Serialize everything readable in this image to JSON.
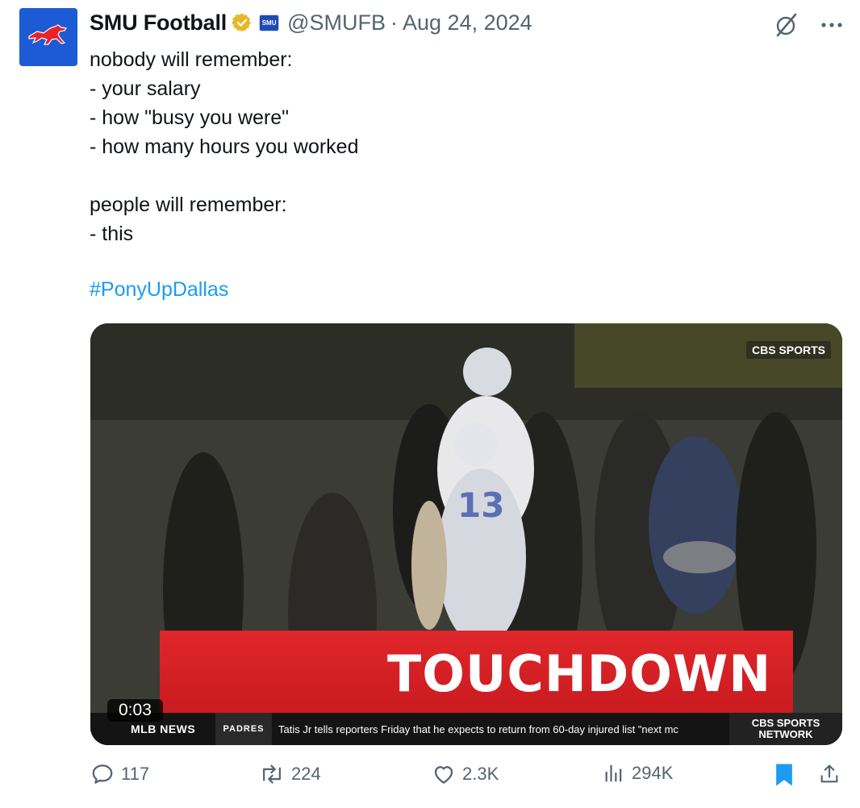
{
  "author": {
    "display_name": "SMU Football",
    "handle": "@SMUFB",
    "separator": "·",
    "date": "Aug 24, 2024",
    "affiliation_badge": "SMU",
    "verified_icon": "gold-check-badge-icon",
    "avatar_icon": "mustang-logo-icon"
  },
  "tweet": {
    "text": "nobody will remember:\n- your salary\n- how \"busy you were\"\n- how many hours you worked\n\npeople will remember:\n- this",
    "hashtag": "#PonyUpDallas"
  },
  "media": {
    "watermark": "CBS SPORTS",
    "banner_text": "TOUCHDOWN",
    "timer": "0:03",
    "ticker": {
      "section": "MLB NEWS",
      "team": "PADRES",
      "news": "Tatis Jr tells reporters Friday that he expects to return from 60-day injured list \"next mc",
      "network_line1": "CBS SPORTS",
      "network_line2": "NETWORK"
    }
  },
  "actions": {
    "replies": "117",
    "reposts": "224",
    "likes": "2.3K",
    "views": "294K"
  },
  "colors": {
    "link": "#1d9bf0",
    "secondary_text": "#536471",
    "bookmark": "#1d9bf0",
    "banner_red": "#d4202a"
  }
}
